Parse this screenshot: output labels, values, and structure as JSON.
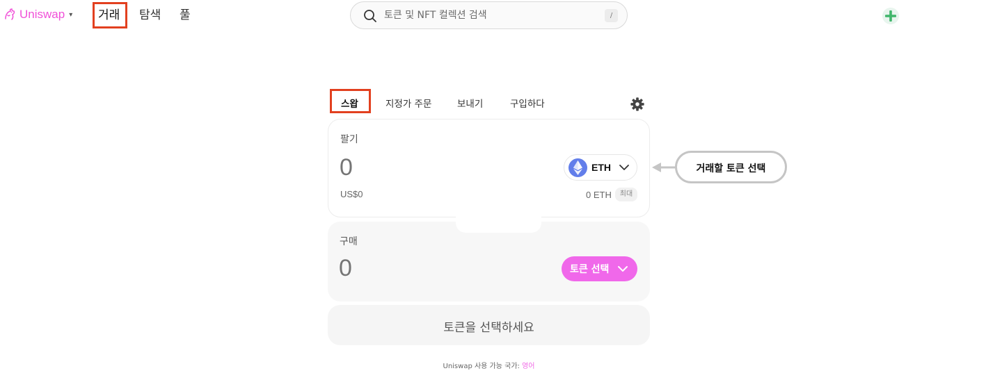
{
  "nav": {
    "logo_text": "Uniswap",
    "logo_caret": "▾",
    "tabs": [
      {
        "label": "거래",
        "active": true
      },
      {
        "label": "탐색",
        "active": false
      },
      {
        "label": "풀",
        "active": false
      }
    ],
    "search": {
      "placeholder": "토큰 및 NFT 컬렉션 검색",
      "shortcut": "/"
    },
    "plus_icon": "plus-icon"
  },
  "swap_tabs": [
    {
      "label": "스왑",
      "active": true
    },
    {
      "label": "지정가 주문",
      "active": false
    },
    {
      "label": "보내기",
      "active": false
    },
    {
      "label": "구입하다",
      "active": false
    }
  ],
  "sell": {
    "label": "팔기",
    "amount": "0",
    "token": "ETH",
    "usd_value": "US$0",
    "balance": "0 ETH",
    "max_label": "최대"
  },
  "buy": {
    "label": "구매",
    "amount": "0",
    "select_label": "토큰 선택"
  },
  "action_button": "토큰을 선택하세요",
  "footer": {
    "text": "Uniswap 사용 가능 국가:",
    "link": "영어"
  },
  "annotation": {
    "text": "거래할 토큰 선택"
  },
  "colors": {
    "brand_pink": "#f050d8",
    "select_pill": "#f068ea",
    "highlight_red": "#e2401f",
    "eth_blue": "#627eea",
    "plus_green": "#40b66b"
  }
}
